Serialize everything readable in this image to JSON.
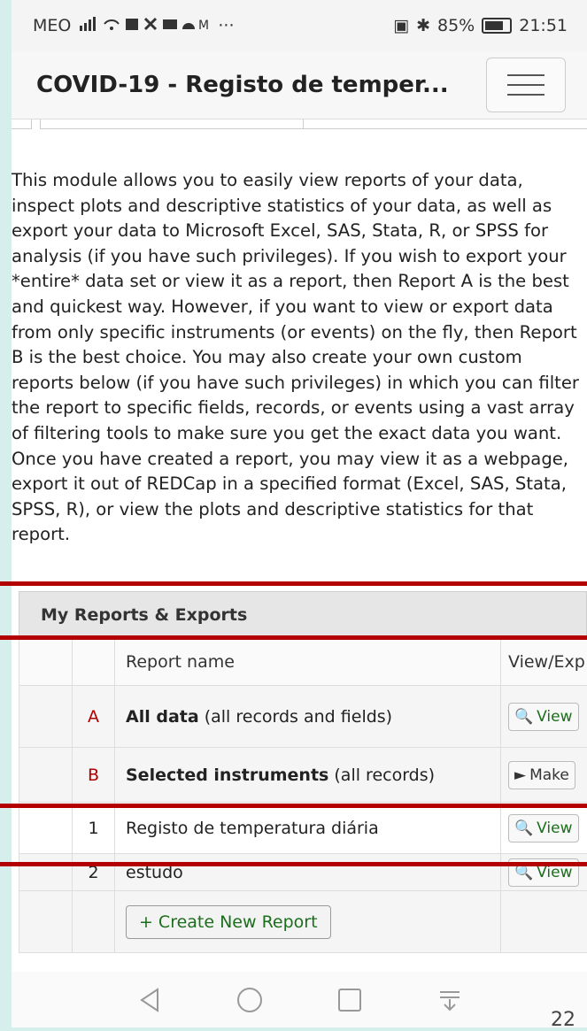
{
  "status_bar": {
    "carrier": "MEO",
    "icons": "signal-wifi-calendar-notifications",
    "right_text": "85%",
    "time": "21:51"
  },
  "navbar": {
    "title": "COVID-19 - Registo de temper..."
  },
  "intro_text": "This module allows you to easily view reports of your data, inspect plots and descriptive statistics of your data, as well as export your data to Microsoft Excel, SAS, Stata, R, or SPSS for analysis (if you have such privileges). If you wish to export your *entire* data set or view it as a report, then Report A is the best and quickest way. However, if you want to view or export data from only specific instruments (or events) on the fly, then Report B is the best choice. You may also create your own custom reports below (if you have such privileges) in which you can filter the report to specific fields, records, or events using a vast array of filtering tools to make sure you get the exact data you want. Once you have created a report, you may view it as a webpage, export it out of REDCap in a specified format (Excel, SAS, Stata, SPSS, R), or view the plots and descriptive statistics for that report.",
  "reports": {
    "panel_title": "My Reports & Exports",
    "col_name": "Report name",
    "col_view": "View/Exp",
    "rows": [
      {
        "id": "A",
        "bold": "All data",
        "rest": " (all records and fields)",
        "action": "View"
      },
      {
        "id": "B",
        "bold": "Selected instruments",
        "rest": " (all records)",
        "action": "Make"
      },
      {
        "id": "1",
        "bold": "",
        "rest": "Registo de temperatura diária",
        "action": "View"
      },
      {
        "id": "2",
        "bold": "",
        "rest": "estudo",
        "action": "View"
      }
    ],
    "create_label": "Create New Report"
  },
  "page_number": "22",
  "colors": {
    "accent_red": "#b30000",
    "button_green": "#1b6e1b"
  }
}
